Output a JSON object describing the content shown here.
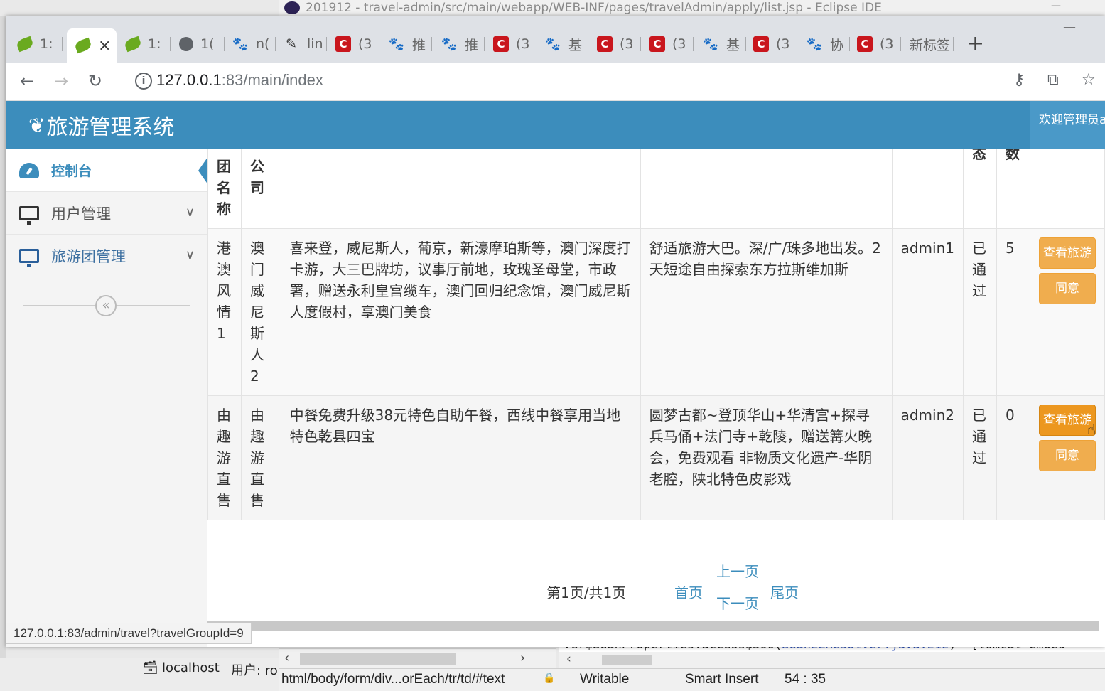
{
  "eclipse": {
    "title": "201912 - travel-admin/src/main/webapp/WEB-INF/pages/travelAdmin/apply/list.jsp - Eclipse IDE",
    "status_path": "html/body/form/div...orEach/tr/td/#text",
    "status_writable": "Writable",
    "status_insert": "Smart Insert",
    "status_position": "54 : 35",
    "console_text_a": "ver$BeanProperties.access$300(",
    "console_text_link": "BeanELResolver.java:212",
    "console_text_b": ") ~[tomcat-embed-",
    "server_label": "localhost",
    "user_label": "用户: ro"
  },
  "browser": {
    "tabs": [
      {
        "label": "1:",
        "icon": "spring-leaf-icon"
      },
      {
        "label": "×",
        "icon": "spring-leaf-icon"
      },
      {
        "label": "1:",
        "icon": "spring-leaf-icon"
      },
      {
        "label": "1(",
        "icon": "globe-icon"
      },
      {
        "label": "n(",
        "icon": "baidu-paw-icon"
      },
      {
        "label": "lin",
        "icon": "pen-icon"
      },
      {
        "label": "(3",
        "icon": "csdn-icon"
      },
      {
        "label": "推",
        "icon": "baidu-paw-icon"
      },
      {
        "label": "推",
        "icon": "baidu-paw-icon"
      },
      {
        "label": "(3",
        "icon": "csdn-icon"
      },
      {
        "label": "基",
        "icon": "baidu-paw-icon"
      },
      {
        "label": "(3",
        "icon": "csdn-icon"
      },
      {
        "label": "(3",
        "icon": "csdn-icon"
      },
      {
        "label": "基",
        "icon": "baidu-paw-icon"
      },
      {
        "label": "(3",
        "icon": "csdn-icon"
      },
      {
        "label": "协",
        "icon": "baidu-paw-icon"
      },
      {
        "label": "(3",
        "icon": "csdn-icon"
      },
      {
        "label": "新标签",
        "icon": ""
      }
    ],
    "new_tab": "+",
    "url_host": "127.0.0.1",
    "url_rest": ":83/main/index",
    "status_tip": "127.0.0.1:83/admin/travel?travelGroupId=9"
  },
  "app": {
    "title": "旅游管理系统",
    "welcome": "欢迎管理员a",
    "sidebar": [
      {
        "label": "控制台",
        "icon": "dashboard-icon",
        "active": true
      },
      {
        "label": "用户管理",
        "icon": "monitor-icon",
        "active": false
      },
      {
        "label": "旅游团管理",
        "icon": "monitor-icon",
        "active": false
      }
    ],
    "collapse": "«"
  },
  "table": {
    "headers": [
      "旅游团名称",
      "旅游公司",
      "",
      "",
      "",
      "状态",
      "人数",
      ""
    ],
    "header_visible": [
      "团名称",
      "公司",
      "",
      "",
      "",
      "态",
      "数",
      ""
    ],
    "rows": [
      {
        "name": "港澳风情1",
        "company": "澳门威尼斯人2",
        "desc": "喜来登，威尼斯人，葡京，新濠摩珀斯等，澳门深度打卡游，大三巴牌坊，议事厅前地，玫瑰圣母堂，市政署，赠送永利皇宫缆车，澳门回归纪念馆，澳门威尼斯人度假村，享澳门美食",
        "intro": "舒适旅游大巴。深/广/珠多地出发。2天短途自由探索东方拉斯维加斯",
        "admin": "admin1",
        "status": "已通过",
        "count": "5",
        "btn_view": "查看旅游",
        "btn_agree": "同意"
      },
      {
        "name": "由趣游直售",
        "company": "由趣游直售",
        "desc": "中餐免费升级38元特色自助午餐，西线中餐享用当地特色乾县四宝",
        "intro": "圆梦古都~登顶华山+华清宫+探寻兵马俑+法门寺+乾陵，赠送篝火晚会，免费观看 非物质文化遗产-华阴老腔，陕北特色皮影戏",
        "admin": "admin2",
        "status": "已通过",
        "count": "0",
        "btn_view": "查看旅游",
        "btn_agree": "同意"
      }
    ]
  },
  "pager": {
    "info": "第1页/共1页",
    "first": "首页",
    "prev": "上一页",
    "next": "下一页",
    "last": "尾页"
  },
  "colors": {
    "header_blue": "#3c8dbc",
    "button_orange": "#f0ad4e"
  }
}
